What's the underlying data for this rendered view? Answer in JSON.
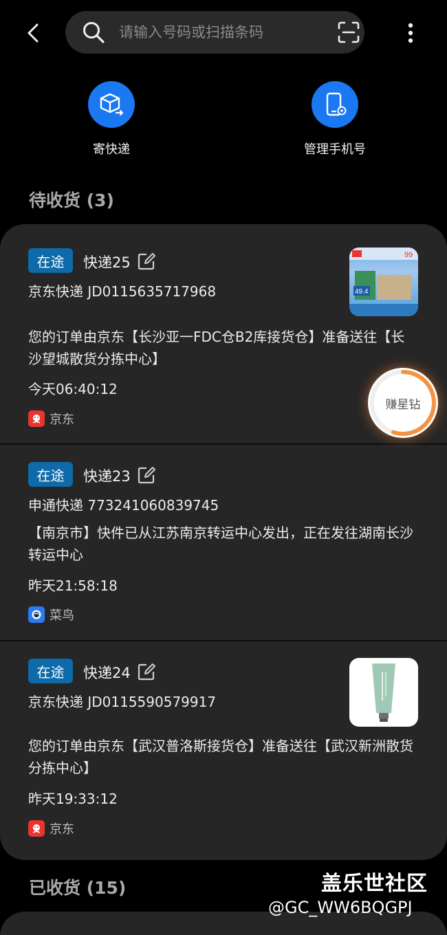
{
  "search": {
    "placeholder": "请输入号码或扫描条码"
  },
  "actions": [
    {
      "label": "寄快递",
      "icon": "box-send-icon"
    },
    {
      "label": "管理手机号",
      "icon": "phone-settings-icon"
    }
  ],
  "pending_section": {
    "title": "待收货 (3)"
  },
  "received_section": {
    "title": "已收货 (15)"
  },
  "packages": [
    {
      "status": "在途",
      "name": "快递25",
      "tracking": "京东快递 JD0115635717968",
      "description": "您的订单由京东【长沙亚一FDC仓B2库接货仓】准备送往【长沙望城散货分拣中心】",
      "time": "今天06:40:12",
      "source": "京东",
      "has_thumbnail": true
    },
    {
      "status": "在途",
      "name": "快递23",
      "tracking": "申通快递 773241060839745",
      "description": "【南京市】快件已从江苏南京转运中心发出，正在发往湖南长沙转运中心",
      "time": "昨天21:58:18",
      "source": "菜鸟",
      "has_thumbnail": false
    },
    {
      "status": "在途",
      "name": "快递24",
      "tracking": "京东快递 JD0115590579917",
      "description": "您的订单由京东【武汉普洛斯接货仓】准备送往【武汉新洲散货分拣中心】",
      "time": "昨天19:33:12",
      "source": "京东",
      "has_thumbnail": true
    }
  ],
  "floating_button": {
    "label": "赚星钻",
    "progress": 0.55
  },
  "watermark": {
    "title": "盖乐世社区",
    "user": "@GC_WW6BQGPJ"
  },
  "thumb_text": {
    "price": "49.4",
    "badge": "99"
  },
  "colors": {
    "accent_blue": "#1a78f2",
    "badge_blue": "#0e6aa8",
    "jd_red": "#e8352e",
    "cainiao_blue": "#2a7af2",
    "ring_orange": "#f59342"
  }
}
